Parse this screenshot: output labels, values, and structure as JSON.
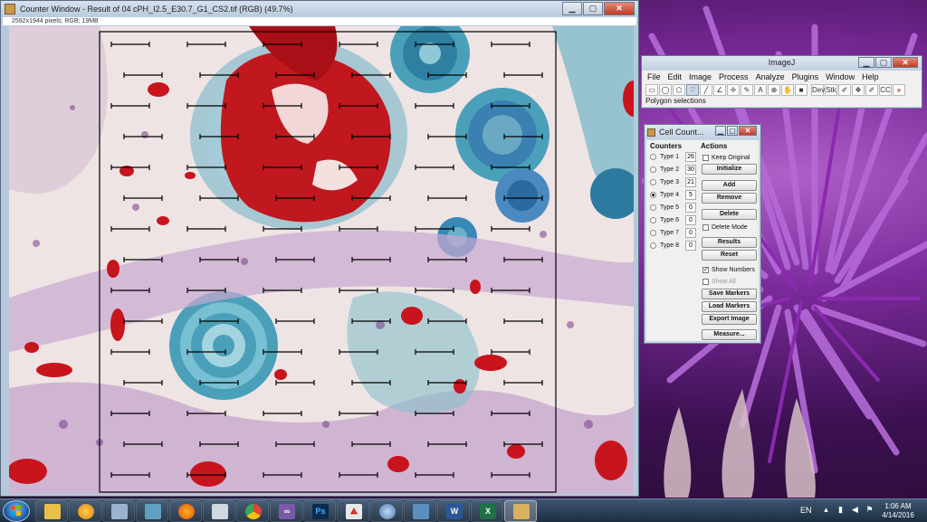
{
  "counter_window": {
    "title": "Counter Window - Result of 04 cPH_I2.5_E30.7_G1_CS2.tif (RGB) (49.7%)",
    "info": "2592x1944 pixels; RGB; 19MB"
  },
  "imagej": {
    "title": "ImageJ",
    "menus": [
      "File",
      "Edit",
      "Image",
      "Process",
      "Analyze",
      "Plugins",
      "Window",
      "Help"
    ],
    "tools": [
      "rectangle-tool",
      "oval-tool",
      "polygon-tool",
      "freehand-tool",
      "line-tool",
      "angle-tool",
      "point-tool",
      "wand-tool",
      "text-tool",
      "zoom-tool",
      "hand-tool",
      "color-picker-tool",
      "developer-menu",
      "stacks-menu",
      "lut-menu",
      "paintbrush-tool",
      "flood-fill-tool",
      "more-tools"
    ],
    "tool_labels": [
      "▭",
      "◯",
      "⬠",
      "♡",
      "╱",
      "∠",
      "✛",
      "✎",
      "A",
      "🔍",
      "✋",
      "■",
      "Dev",
      "Stk",
      "✐",
      "❖",
      "✐",
      "CC",
      "»"
    ],
    "active_tool": "polygon-tool",
    "status": "Polygon selections"
  },
  "cell_counter": {
    "title": "Cell Count...",
    "counters_heading": "Counters",
    "actions_heading": "Actions",
    "counters": [
      {
        "label": "Type 1",
        "count": "26"
      },
      {
        "label": "Type 2",
        "count": "30"
      },
      {
        "label": "Type 3",
        "count": "21"
      },
      {
        "label": "Type 4",
        "count": "5"
      },
      {
        "label": "Type 5",
        "count": "0"
      },
      {
        "label": "Type 6",
        "count": "0"
      },
      {
        "label": "Type 7",
        "count": "0"
      },
      {
        "label": "Type 8",
        "count": "0"
      }
    ],
    "selected_counter": "Type 4",
    "keep_original": "Keep Original",
    "initialize": "Initialize",
    "add": "Add",
    "remove": "Remove",
    "delete": "Delete",
    "delete_mode": "Delete Mode",
    "results": "Results",
    "reset": "Reset",
    "show_numbers": "Show Numbers",
    "show_all": "Show All",
    "save_markers": "Save Markers",
    "load_markers": "Load Markers",
    "export_image": "Export Image",
    "measure": "Measure..."
  },
  "taskbar": {
    "apps": [
      "start-button",
      "file-explorer-icon",
      "chrome-alt-icon",
      "calculator-icon",
      "notes-icon",
      "firefox-icon",
      "paint-icon",
      "chrome-icon",
      "visual-studio-icon",
      "photoshop-icon",
      "acrobat-icon",
      "disk-utility-icon",
      "photo-viewer-icon",
      "word-icon",
      "excel-icon",
      "imagej-icon"
    ],
    "language": "EN",
    "time": "1:06 AM",
    "date": "4/14/2016"
  },
  "colors": {
    "stain_red": "#c0181e",
    "stain_blue": "#4aa0b8",
    "tissue_purple": "#8a4a90",
    "background": "#efe6e6",
    "window_chrome": "#c9d6e6"
  }
}
